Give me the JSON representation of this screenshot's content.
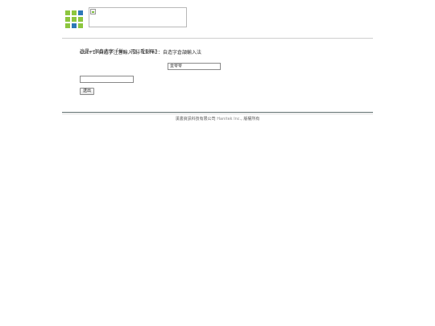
{
  "header": {
    "logo": {
      "name": "logo-squares",
      "colors": {
        "green": "#8dc63f",
        "blue": "#2e78b8"
      }
    },
    "banner_image": "broken-image"
  },
  "main": {
    "hint": "Ctrl+1: 自造字注音輸入法，Ctrl+2：自造字倉頡輸入法",
    "question": "這是一個自造字「𫢸」，可以看到嗎？",
    "captcha_value": "壹零零",
    "answer_value": "",
    "answer_placeholder": "",
    "submit_label": "送出"
  },
  "footer": {
    "company_zh": "漢書資訊科技有限公司",
    "company_en": "Hanitek Inc.",
    "rights": "版權所有"
  },
  "colors": {
    "rule_top": "#cfcfcf",
    "rule_bottom": "#5f6f6f",
    "text": "#333333"
  }
}
